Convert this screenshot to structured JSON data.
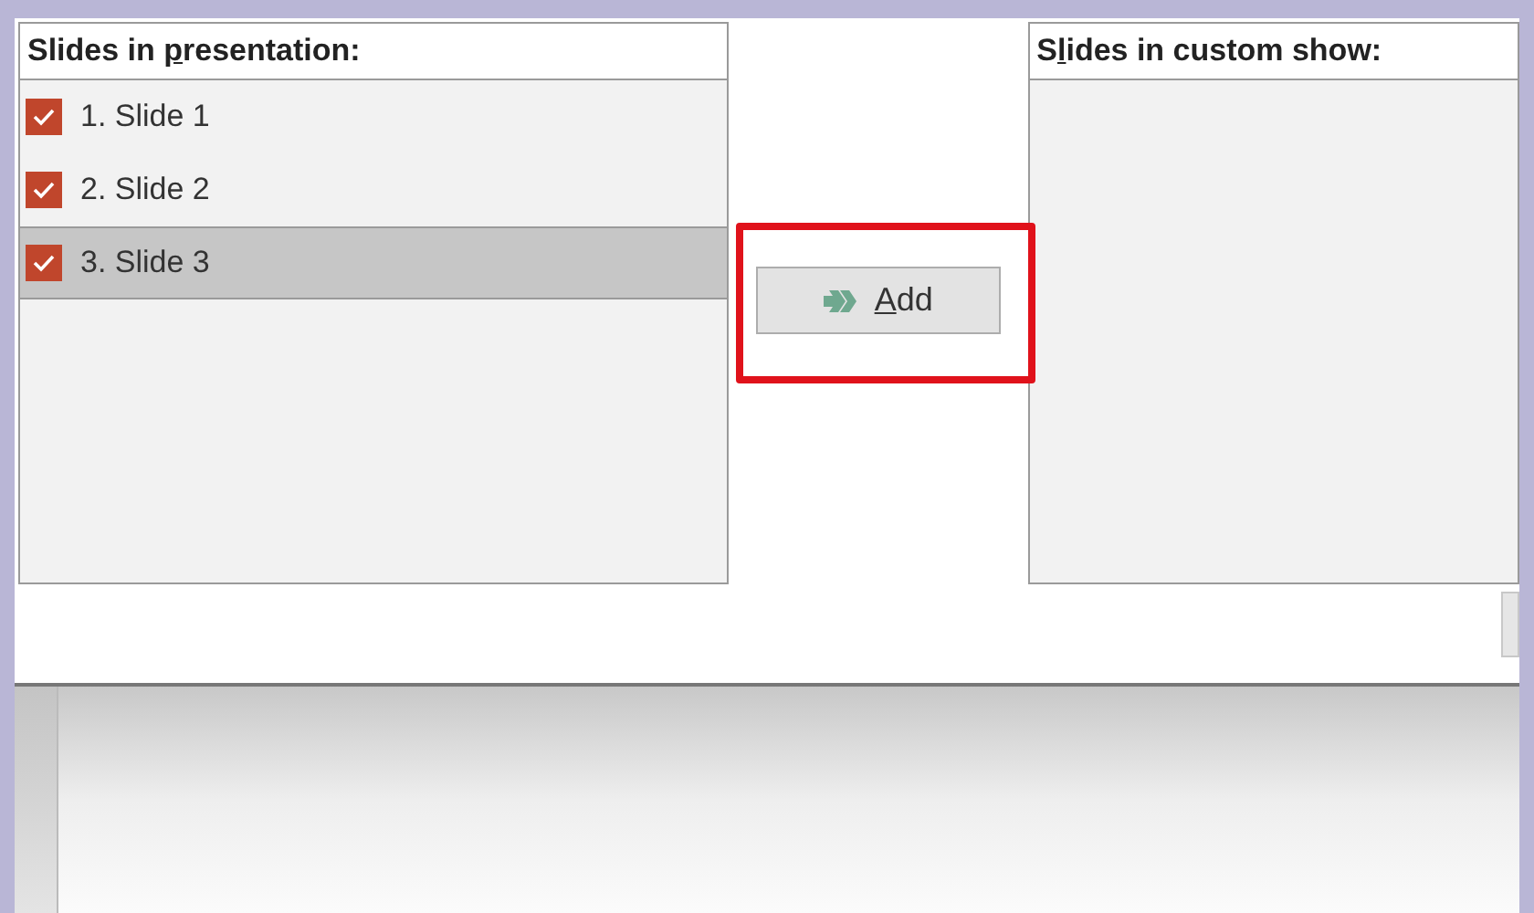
{
  "presentation_list": {
    "heading": {
      "before": "Slides in ",
      "key": "p",
      "after": "resentation:"
    },
    "items": [
      {
        "label": "1. Slide 1",
        "checked": true,
        "selected": false
      },
      {
        "label": "2. Slide 2",
        "checked": true,
        "selected": false
      },
      {
        "label": "3. Slide 3",
        "checked": true,
        "selected": true
      }
    ]
  },
  "add_button": {
    "key": "A",
    "after": "dd",
    "highlighted": true
  },
  "custom_show_list": {
    "heading": {
      "before": "S",
      "key": "l",
      "after": "ides in custom show:"
    }
  }
}
